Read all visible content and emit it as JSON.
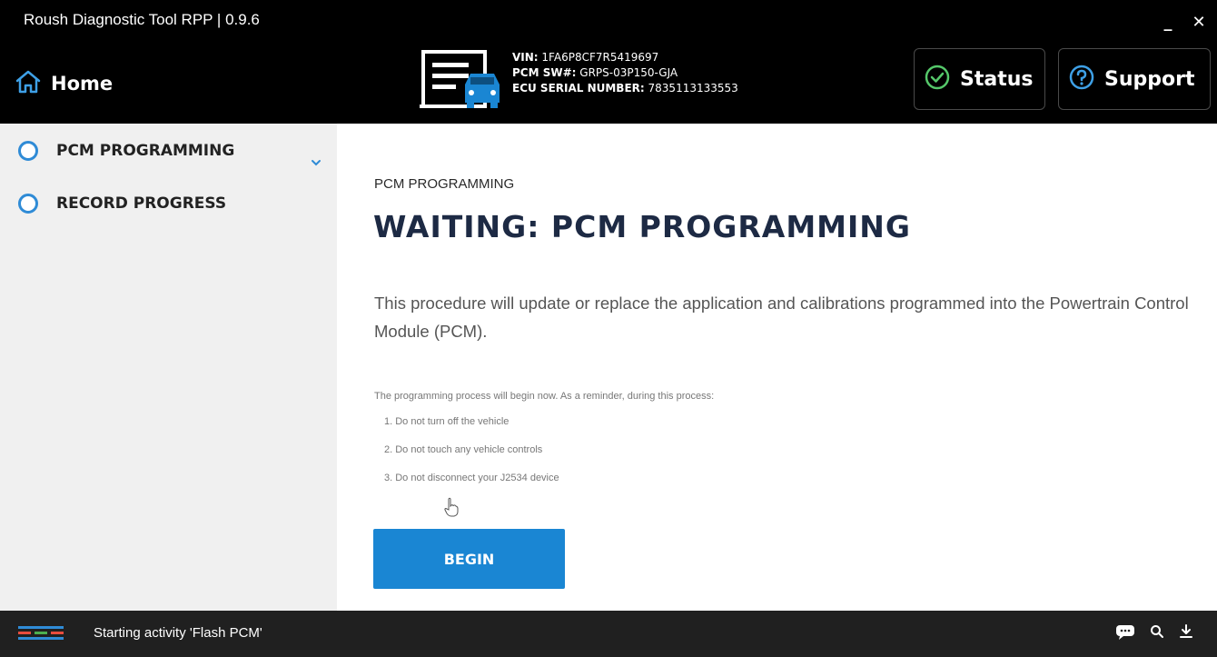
{
  "window": {
    "title": "Roush Diagnostic Tool RPP | 0.9.6",
    "minimize": "_",
    "close": "✕"
  },
  "header": {
    "home_label": "Home",
    "home_icon": "home-icon",
    "vehicle_icon": "vehicle-document-icon",
    "vin_label": "VIN:",
    "vin_value": "1FA6P8CF7R5419697",
    "pcm_sw_label": "PCM SW#:",
    "pcm_sw_value": "GRPS-03P150-GJA",
    "ecu_label": "ECU SERIAL NUMBER:",
    "ecu_value": "7835113133553",
    "status_label": "Status",
    "status_icon": "check-circle-icon",
    "support_label": "Support",
    "support_icon": "question-circle-icon"
  },
  "sidebar": {
    "items": [
      {
        "label": "PCM PROGRAMMING",
        "expanded": true
      },
      {
        "label": "RECORD PROGRESS"
      }
    ]
  },
  "main": {
    "breadcrumb": "PCM PROGRAMMING",
    "title": "WAITING: PCM PROGRAMMING",
    "description": "This procedure will update or replace the application and calibrations programmed into the Powertrain Control Module (PCM).",
    "reminder": "The programming process will begin now. As a reminder, during this process:",
    "steps": [
      "1. Do not turn off the vehicle",
      "2. Do not touch any vehicle controls",
      "3. Do not disconnect your J2534 device"
    ],
    "begin_label": "BEGIN"
  },
  "taskbar": {
    "status_text": "Starting activity 'Flash PCM'",
    "icons": [
      "chat-icon",
      "search-icon",
      "download-icon"
    ]
  },
  "colors": {
    "accent": "#1a86d3",
    "ring": "#2f8bd6",
    "headline": "#1d2a44",
    "header_bg": "#000000",
    "sidebar_bg": "#f0f0f0",
    "taskbar_bg": "#202020"
  }
}
